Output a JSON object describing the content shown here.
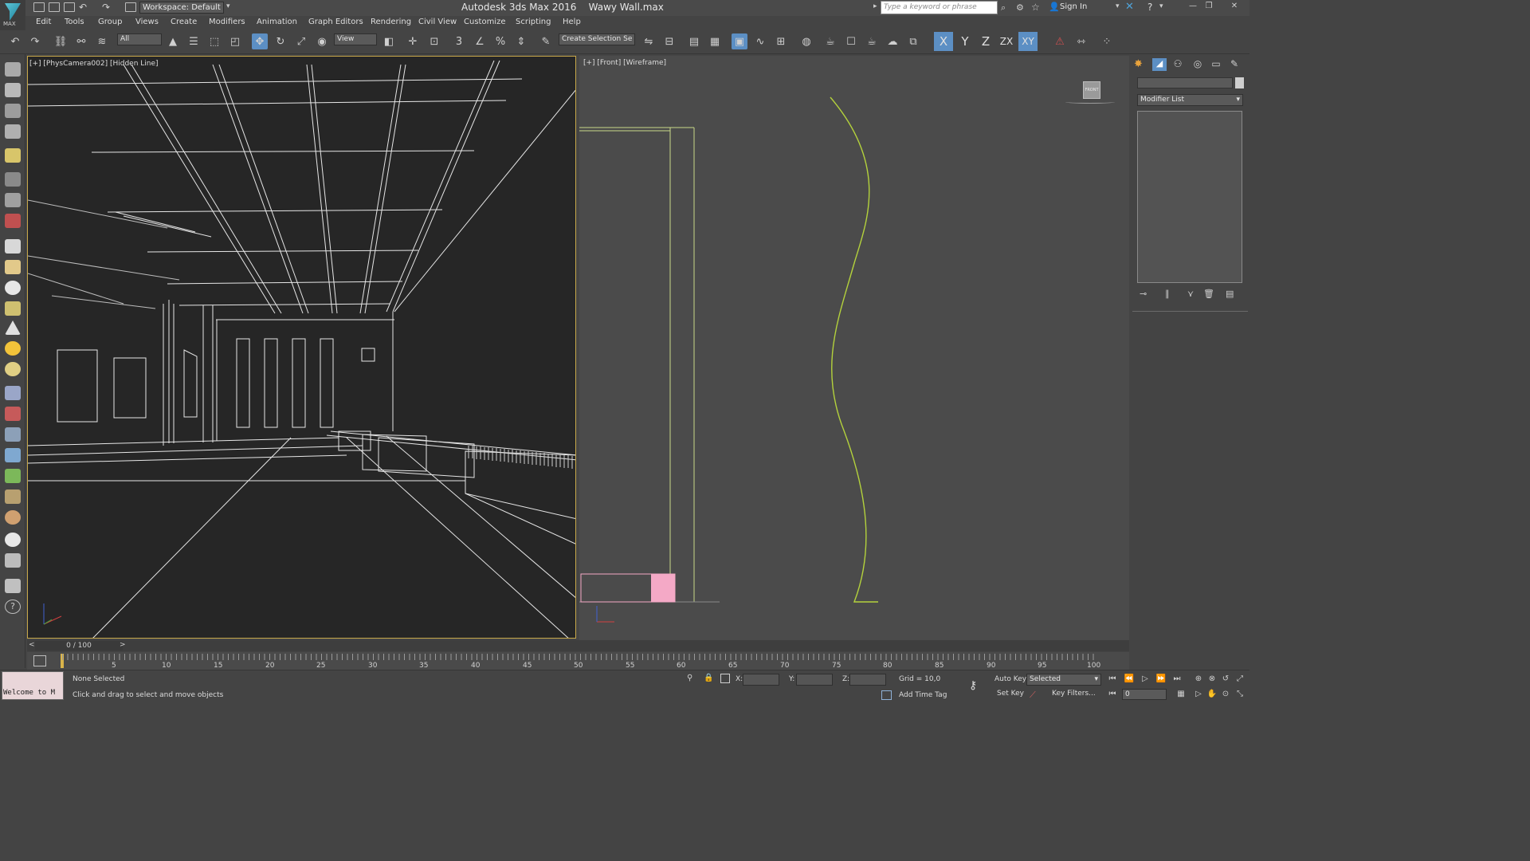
{
  "app": {
    "title": "Autodesk 3ds Max 2016",
    "file": "Wawy Wall.max",
    "logo_text": "MAX",
    "workspace": "Workspace: Default",
    "search_placeholder": "Type a keyword or phrase",
    "sign_in": "Sign In"
  },
  "menu": [
    "Edit",
    "Tools",
    "Group",
    "Views",
    "Create",
    "Modifiers",
    "Animation",
    "Graph Editors",
    "Rendering",
    "Civil View",
    "Customize",
    "Scripting",
    "Help"
  ],
  "toolbar": {
    "selection_filter": "All",
    "ref_coord": "View",
    "named_selection": "Create Selection Se",
    "snap_3": "3",
    "angle_percent": "%",
    "axes": [
      "X",
      "Y",
      "Z",
      "ZX",
      "XY"
    ]
  },
  "viewports": {
    "left_label": "[+] [PhysCamera002] [Hidden Line]",
    "right_label": "[+] [Front] [Wireframe]",
    "viewcube_label": "FRONT"
  },
  "command_panel": {
    "modifier_list": "Modifier List"
  },
  "timeline": {
    "frame_indicator": "0 / 100",
    "ticks": [
      "5",
      "10",
      "15",
      "20",
      "25",
      "30",
      "35",
      "40",
      "45",
      "50",
      "55",
      "60",
      "65",
      "70",
      "75",
      "80",
      "85",
      "90",
      "95",
      "100"
    ]
  },
  "status": {
    "maxscript": "Welcome to M",
    "selection": "None Selected",
    "prompt": "Click and drag to select and move objects",
    "x_label": "X:",
    "y_label": "Y:",
    "z_label": "Z:",
    "grid": "Grid = 10,0",
    "add_time_tag": "Add Time Tag",
    "auto_key": "Auto Key",
    "set_key": "Set Key",
    "selected": "Selected",
    "key_filters": "Key Filters...",
    "frame": "0"
  },
  "colors": {
    "curve": "#b4d23c",
    "selection_border": "#c8a84a",
    "pink_object": "#f4a9c6"
  }
}
